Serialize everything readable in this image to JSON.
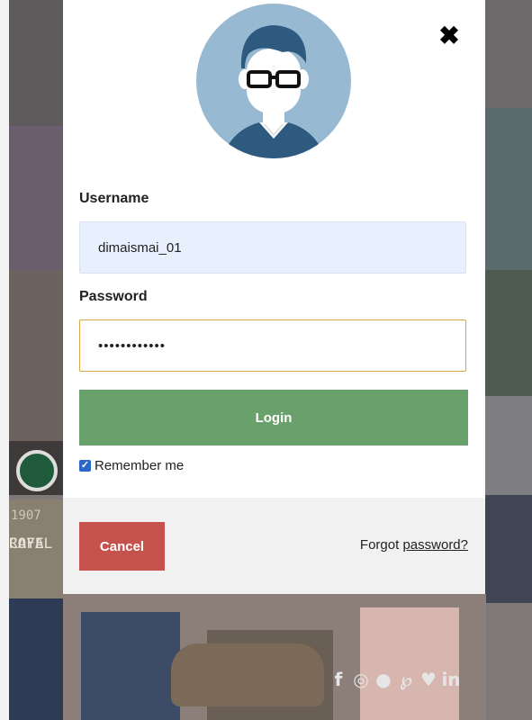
{
  "modal": {
    "close_glyph": "✖",
    "username": {
      "label": "Username",
      "value": "dimaismai_01"
    },
    "password": {
      "label": "Password",
      "value": "••••••••••••"
    },
    "login_label": "Login",
    "remember": {
      "label": "Remember me",
      "checked": true
    },
    "cancel_label": "Cancel",
    "forgot": {
      "prefix": "Forgot ",
      "link": "password?"
    }
  },
  "background": {
    "cafe_year": "1907",
    "cafe_name_line1": "CAFE",
    "cafe_name_line2": "ROYAL"
  },
  "social": [
    {
      "icon": "facebook-icon",
      "glyph": "f"
    },
    {
      "icon": "instagram-icon",
      "glyph": "◎"
    },
    {
      "icon": "snapchat-icon",
      "glyph": "●"
    },
    {
      "icon": "pinterest-icon",
      "glyph": "℘"
    },
    {
      "icon": "twitter-icon",
      "glyph": "♥"
    },
    {
      "icon": "linkedin-icon",
      "glyph": "in"
    }
  ],
  "colors": {
    "login": "#6aa06c",
    "cancel": "#c6524d",
    "avatar_bg": "#97b9d1",
    "username_bg": "#e8f0fe",
    "password_border": "#d9a441"
  }
}
